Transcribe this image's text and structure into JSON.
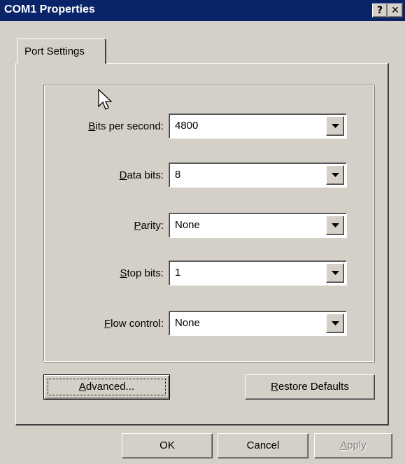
{
  "window": {
    "title": "COM1 Properties",
    "help_label": "?",
    "close_label": "✕"
  },
  "tabs": [
    {
      "label": "Port Settings",
      "selected": true
    }
  ],
  "fields": [
    {
      "key": "bits_per_second",
      "mnemonic": "B",
      "label_rest": "its per second:",
      "value": "4800"
    },
    {
      "key": "data_bits",
      "mnemonic": "D",
      "label_rest": "ata bits:",
      "value": "8"
    },
    {
      "key": "parity",
      "mnemonic": "P",
      "label_rest": "arity:",
      "value": "None"
    },
    {
      "key": "stop_bits",
      "mnemonic": "S",
      "label_rest": "top bits:",
      "value": "1"
    },
    {
      "key": "flow_control",
      "mnemonic": "F",
      "label_rest": "low control:",
      "value": "None"
    }
  ],
  "buttons": {
    "advanced": {
      "mnemonic": "A",
      "rest": "dvanced..."
    },
    "restore_defaults": {
      "mnemonic": "R",
      "rest": "estore Defaults"
    },
    "ok": "OK",
    "cancel": "Cancel",
    "apply": {
      "mnemonic": "A",
      "rest": "pply",
      "enabled": false
    }
  },
  "icons": {
    "combo_arrow": "dropdown-arrow-icon",
    "cursor": "mouse-pointer-icon"
  },
  "colors": {
    "titlebar": "#0a246a",
    "face": "#d4d0c8",
    "field_bg": "#ffffff"
  }
}
